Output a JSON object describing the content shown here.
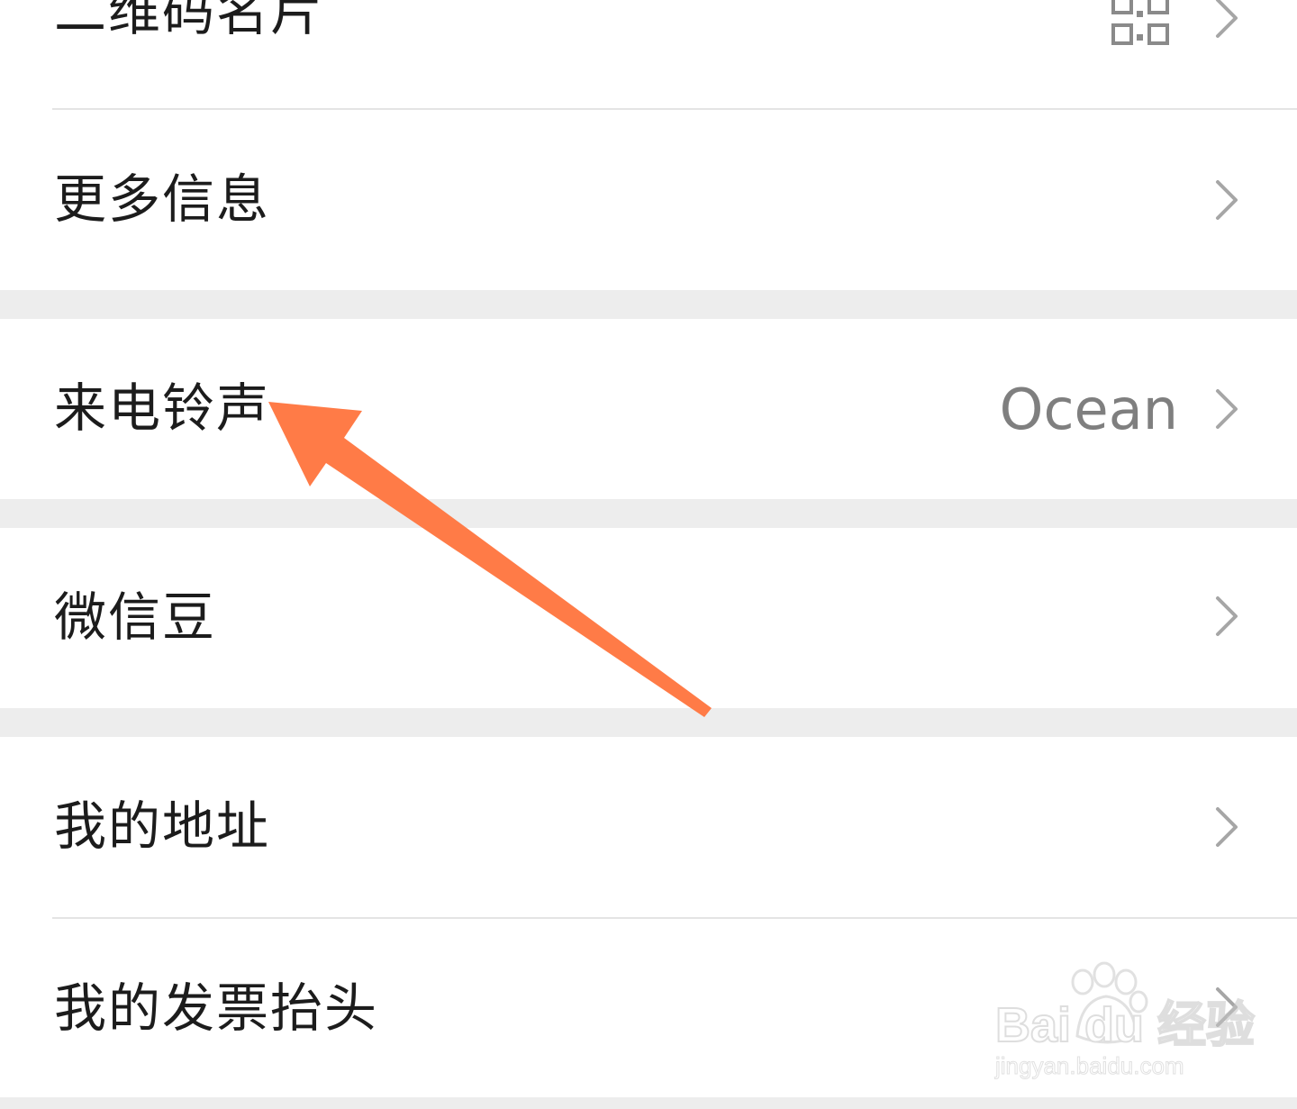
{
  "menu": {
    "items": [
      {
        "label": "二维码名片",
        "has_qr_icon": true
      },
      {
        "label": "更多信息"
      },
      {
        "label": "来电铃声",
        "value": "Ocean"
      },
      {
        "label": "微信豆"
      },
      {
        "label": "我的地址"
      },
      {
        "label": "我的发票抬头"
      }
    ]
  },
  "annotation": {
    "arrow_color": "#ff7b47"
  },
  "watermark": {
    "brand": "Bai du 经验",
    "url": "jingyan.baidu.com"
  },
  "colors": {
    "background": "#ffffff",
    "separator": "#ededed",
    "text": "#1c1c1c",
    "secondary_text": "#7f7f7f",
    "chevron": "#a6a6a6"
  }
}
